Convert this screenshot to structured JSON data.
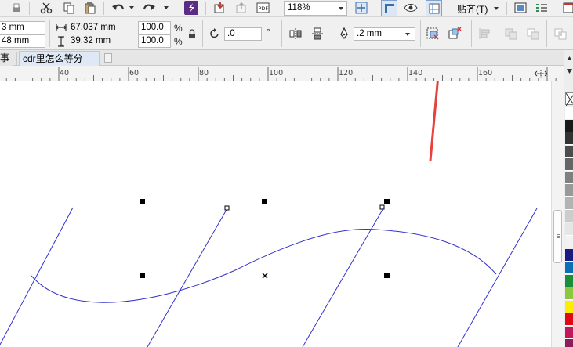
{
  "toolbar": {
    "zoom": "118%",
    "snap_label": "贴齐(T)"
  },
  "property_bar": {
    "pos_x": "3 mm",
    "pos_y": "48 mm",
    "width": "67.037 mm",
    "height": "39.32 mm",
    "scale_w": "100.0",
    "scale_h": "100.0",
    "percent": "%",
    "rotation": ".0",
    "degree": "°",
    "outline_width": ".2 mm"
  },
  "tabs": [
    {
      "label": "事"
    },
    {
      "label": "cdr里怎么等分"
    }
  ],
  "ruler": {
    "ticks": [
      "40",
      "60",
      "80",
      "100",
      "120",
      "140",
      "160"
    ]
  },
  "colors": {
    "curve": "#3333cc",
    "annotation_arrow": "#e8403a",
    "palette": [
      "#ffffff",
      "#1a1a1a",
      "#333333",
      "#4d4d4d",
      "#666666",
      "#808080",
      "#999999",
      "#b3b3b3",
      "#cccccc",
      "#e6e6e6",
      "#f2f2f2",
      "#1a1a80",
      "#0b6fb5",
      "#1a8f3a",
      "#8dc63f",
      "#ffed00",
      "#e30613",
      "#c2185b",
      "#8e1c5a"
    ]
  }
}
